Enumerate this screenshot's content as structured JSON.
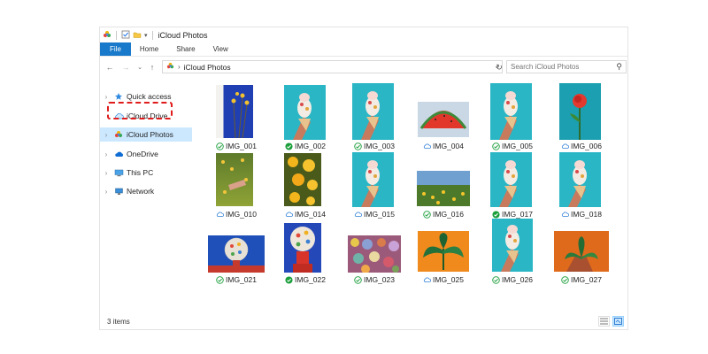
{
  "window": {
    "title": "iCloud Photos"
  },
  "ribbon": {
    "tabs": [
      "File",
      "Home",
      "Share",
      "View"
    ]
  },
  "address": {
    "crumb": "iCloud Photos"
  },
  "search": {
    "placeholder": "Search iCloud Photos"
  },
  "nav": {
    "items": [
      {
        "label": "Quick access",
        "icon": "star-icon"
      },
      {
        "label": "iCloud Drive",
        "icon": "cloud-icon"
      },
      {
        "label": "iCloud Photos",
        "icon": "photos-icon",
        "selected": true
      },
      {
        "label": "OneDrive",
        "icon": "onedrive-icon"
      },
      {
        "label": "This PC",
        "icon": "computer-icon"
      },
      {
        "label": "Network",
        "icon": "network-icon"
      }
    ]
  },
  "files": [
    {
      "name": "IMG_001",
      "status": "synced"
    },
    {
      "name": "IMG_002",
      "status": "synced-full"
    },
    {
      "name": "IMG_003",
      "status": "synced"
    },
    {
      "name": "IMG_004",
      "status": "cloud"
    },
    {
      "name": "IMG_005",
      "status": "synced"
    },
    {
      "name": "IMG_006",
      "status": "cloud"
    },
    {
      "name": "IMG_010",
      "status": "cloud"
    },
    {
      "name": "IMG_014",
      "status": "cloud"
    },
    {
      "name": "IMG_015",
      "status": "cloud"
    },
    {
      "name": "IMG_016",
      "status": "synced"
    },
    {
      "name": "IMG_017",
      "status": "synced-full"
    },
    {
      "name": "IMG_018",
      "status": "cloud"
    },
    {
      "name": "IMG_021",
      "status": "synced"
    },
    {
      "name": "IMG_022",
      "status": "synced-full"
    },
    {
      "name": "IMG_023",
      "status": "synced"
    },
    {
      "name": "IMG_025",
      "status": "cloud"
    },
    {
      "name": "IMG_026",
      "status": "synced"
    },
    {
      "name": "IMG_027",
      "status": "synced"
    }
  ],
  "statusbar": {
    "count": "3 items"
  },
  "colors": {
    "accent": "#1979ca",
    "selection": "#cce8ff",
    "highlight": "#e01c1c",
    "synced": "#1a9e3a",
    "cloud": "#2f7fd6"
  }
}
